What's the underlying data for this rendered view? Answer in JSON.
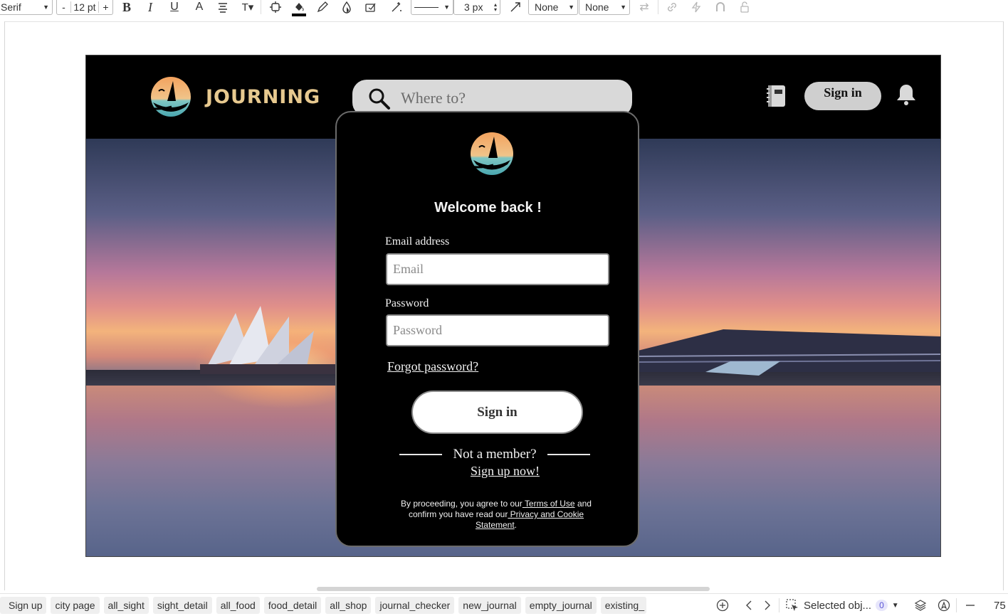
{
  "toolbar": {
    "font_family": "Serif",
    "font_size": "12 pt",
    "minus_label": "-",
    "plus_label": "+",
    "line_width": "3 px",
    "arrow_start": "None",
    "arrow_end": "None",
    "accent_color": "#000000"
  },
  "site": {
    "brand": "JOURNING",
    "brand_color": "#e7c98f",
    "search_placeholder": "Where to?",
    "signin_label": "Sign in"
  },
  "modal": {
    "title": "Welcome back !",
    "email_label": "Email address",
    "email_placeholder": "Email",
    "password_label": "Password",
    "password_placeholder": "Password",
    "forgot_label": "Forgot password?",
    "signin_label": "Sign in",
    "not_member": "Not a member?",
    "signup_label": "Sign up now!",
    "legal_prefix": "By proceeding, you agree to our",
    "terms_label": " Terms of Use",
    "legal_mid": " and confirm you have read our",
    "privacy_label": " Privacy and Cookie Statement",
    "legal_suffix": "."
  },
  "pages": {
    "tabs": [
      "Sign up",
      "city page",
      "all_sight",
      "sight_detail",
      "all_food",
      "food_detail",
      "all_shop",
      "journal_checker",
      "new_journal",
      "empty_journal",
      "existing_"
    ]
  },
  "status": {
    "selected_label": "Selected obj...",
    "selected_count": "0",
    "zoom": "75"
  }
}
